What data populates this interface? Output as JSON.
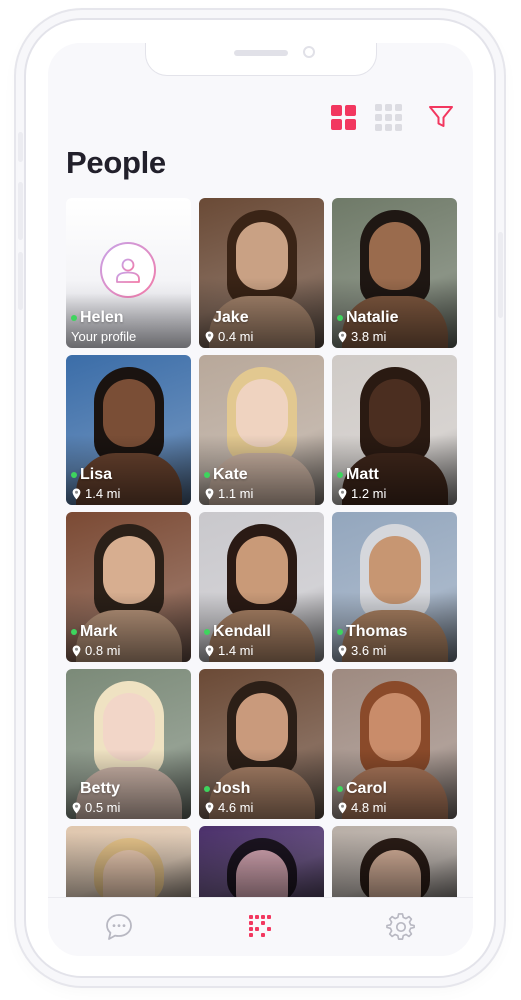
{
  "header": {
    "title": "People",
    "grid_large_icon": "grid-2x2-icon",
    "grid_small_icon": "grid-3x3-icon",
    "filter_icon": "filter-icon"
  },
  "colors": {
    "accent": "#f2375f",
    "inactive": "#dcdce2",
    "online": "#3ed55e",
    "title": "#22202b"
  },
  "people": [
    {
      "name": "Helen",
      "distance": "Your profile",
      "own": true,
      "online": true
    },
    {
      "name": "Jake",
      "distance": "0.4 mi",
      "online": false,
      "bg": "#6a4a36",
      "skin": "#c9a184",
      "hair": "#3a2416"
    },
    {
      "name": "Natalie",
      "distance": "3.8 mi",
      "online": true,
      "bg": "#6f7a68",
      "skin": "#9a6b4d",
      "hair": "#1f1713"
    },
    {
      "name": "Lisa",
      "distance": "1.4 mi",
      "online": true,
      "bg": "#3b6da8",
      "skin": "#7a4e36",
      "hair": "#1a1310"
    },
    {
      "name": "Kate",
      "distance": "1.1 mi",
      "online": true,
      "bg": "#b8a89a",
      "skin": "#efd3c0",
      "hair": "#e2c890"
    },
    {
      "name": "Matt",
      "distance": "1.2 mi",
      "online": true,
      "bg": "#cfcac6",
      "skin": "#4b2e20",
      "hair": "#2a1a12"
    },
    {
      "name": "Mark",
      "distance": "0.8 mi",
      "online": true,
      "bg": "#7b4a34",
      "skin": "#d7ae90",
      "hair": "#2b2018"
    },
    {
      "name": "Kendall",
      "distance": "1.4 mi",
      "online": true,
      "bg": "#c9c8cc",
      "skin": "#c99a78",
      "hair": "#2a1a14"
    },
    {
      "name": "Thomas",
      "distance": "3.6 mi",
      "online": true,
      "bg": "#93a6bd",
      "skin": "#c79672",
      "hair": "#d5d7dc"
    },
    {
      "name": "Betty",
      "distance": "0.5 mi",
      "online": false,
      "bg": "#7b8a78",
      "skin": "#f2d6c8",
      "hair": "#efe2c2"
    },
    {
      "name": "Josh",
      "distance": "4.6 mi",
      "online": true,
      "bg": "#6b4a36",
      "skin": "#c99a7c",
      "hair": "#2c1f17"
    },
    {
      "name": "Carol",
      "distance": "4.8 mi",
      "online": true,
      "bg": "#9e8a80",
      "skin": "#c98c6a",
      "hair": "#8a4a2a"
    },
    {
      "partial": true,
      "bg": "#e0c7ae",
      "skin": "#f0cfb6",
      "hair": "#e6c48a"
    },
    {
      "partial": true,
      "bg": "#4a2f6a",
      "skin": "#d9a9b6",
      "hair": "#1b1420"
    },
    {
      "partial": true,
      "bg": "#b8aea6",
      "skin": "#d9b39c",
      "hair": "#2a1c16"
    }
  ],
  "tabbar": {
    "tabs": [
      {
        "icon": "chat-bubble-icon",
        "active": false
      },
      {
        "icon": "people-grid-icon",
        "active": true
      },
      {
        "icon": "gear-icon",
        "active": false
      }
    ]
  }
}
